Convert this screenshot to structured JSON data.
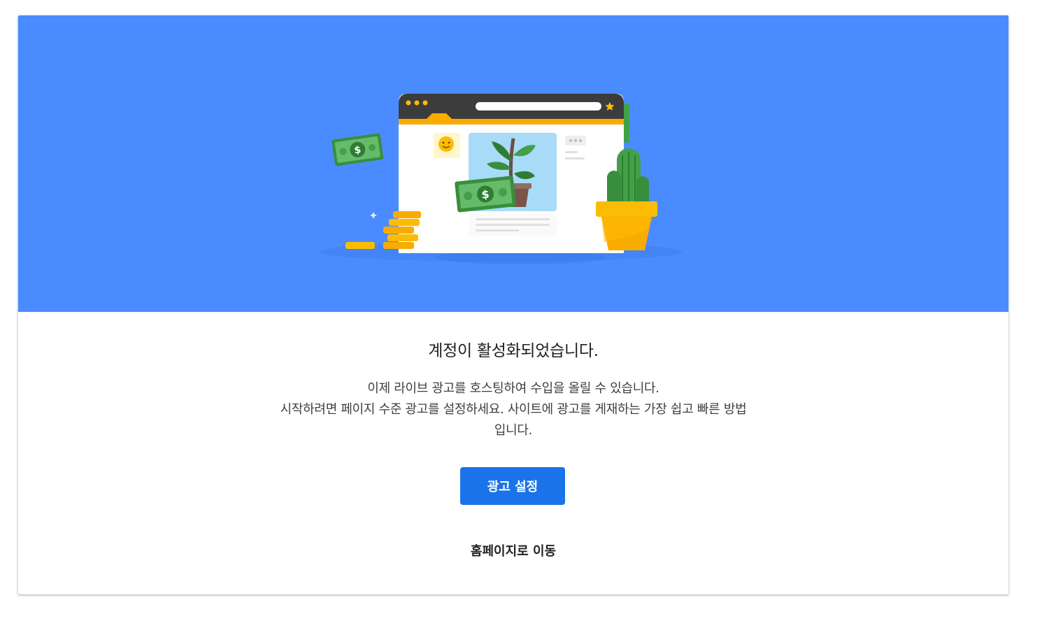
{
  "hero": {
    "background_color": "#4a8cff",
    "illustration": "browser-window-with-plant-money-cactus-coins",
    "currency_symbol": "$"
  },
  "activation": {
    "title": "계정이 활성화되었습니다.",
    "description_lines": [
      "이제 라이브 광고를 호스팅하여 수입을 올릴 수 있습니다.",
      "시작하려면 페이지 수준 광고를 설정하세요. 사이트에 광고를 게재하는 가장 쉽고 빠른 방법",
      "입니다."
    ]
  },
  "actions": {
    "primary_label": "광고 설정",
    "primary_color": "#1a73e8",
    "secondary_label": "홈페이지로 이동"
  }
}
